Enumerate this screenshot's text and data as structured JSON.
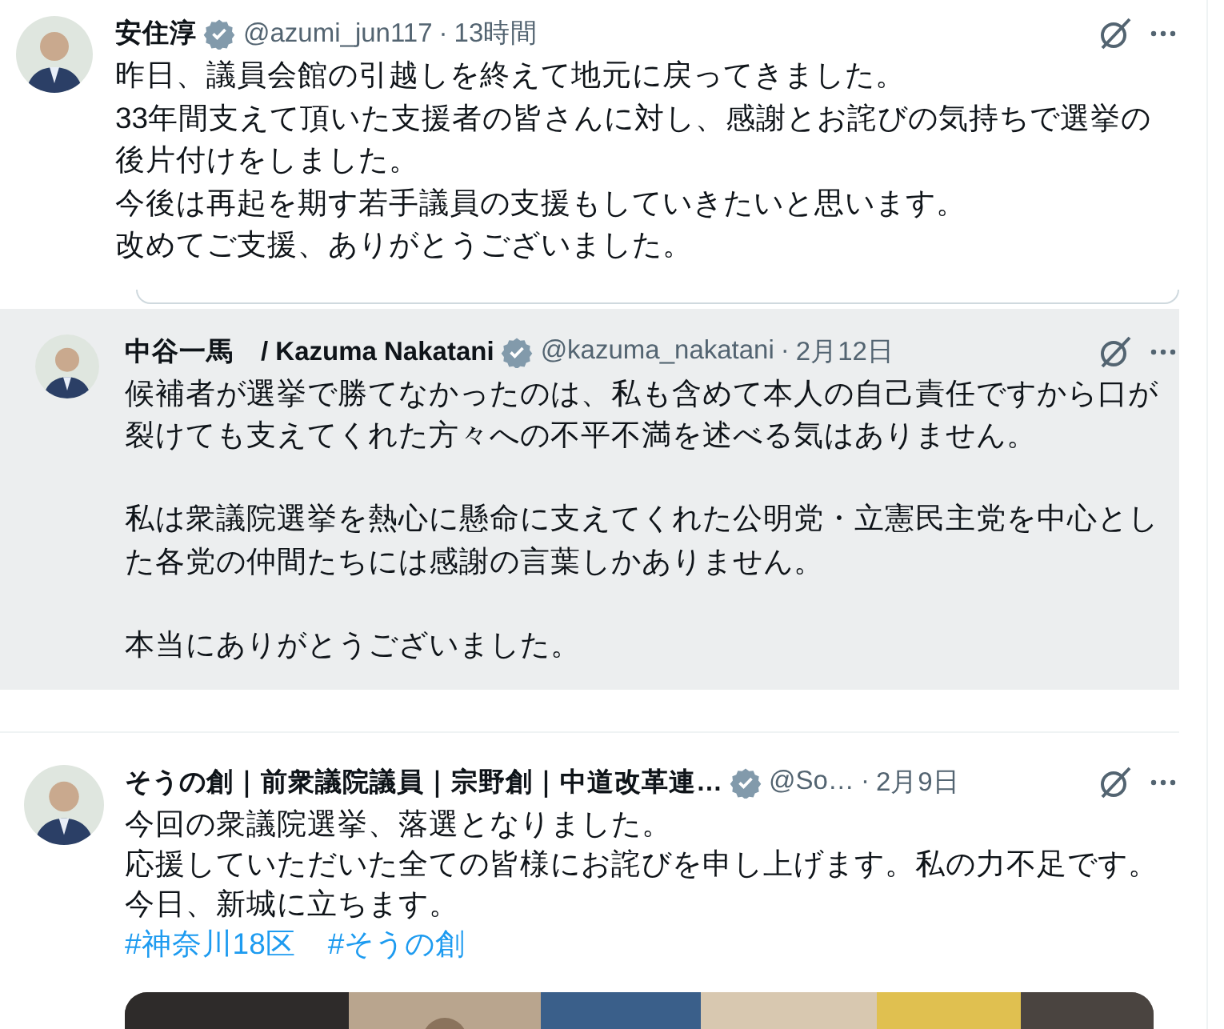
{
  "tweets": [
    {
      "hovered": false,
      "name": "安住淳",
      "verified": true,
      "handle": "@azumi_jun117",
      "dot": "·",
      "time": "13時間",
      "paragraphs": [
        [
          "昨日、議員会館の引越しを終えて地元に戻ってきました。",
          "33年間支えて頂いた支援者の皆さんに対し、感謝とお詫びの気持ちで選挙の後片付けをしました。",
          "今後は再起を期す若手議員の支援もしていきたいと思います。",
          "改めてご支援、ありがとうございました。"
        ]
      ]
    },
    {
      "hovered": true,
      "name": "中谷一馬　/ Kazuma Nakatani",
      "verified": true,
      "handle": "@kazuma_nakatani",
      "dot": "·",
      "time": "2月12日",
      "paragraphs": [
        [
          "候補者が選挙で勝てなかったのは、私も含めて本人の自己責任ですから口が裂けても支えてくれた方々への不平不満を述べる気はありません。"
        ],
        [
          "私は衆議院選挙を熱心に懸命に支えてくれた公明党・立憲民主党を中心とした各党の仲間たちには感謝の言葉しかありません。"
        ],
        [
          "本当にありがとうございました。"
        ]
      ]
    },
    {
      "hovered": false,
      "name": "そうの創｜前衆議院議員｜宗野創｜中道改革連…",
      "verified": true,
      "handle": "@So…",
      "dot": "·",
      "time": "2月9日",
      "paragraphs": [
        [
          "今回の衆議院選挙、落選となりました。",
          "応援していただいた全ての皆様にお詫びを申し上げます。私の力不足です。",
          "今日、新城に立ちます。"
        ]
      ],
      "hashtags": [
        "#神奈川18区",
        "#そうの創"
      ],
      "media": {
        "kind": "picture"
      }
    }
  ]
}
